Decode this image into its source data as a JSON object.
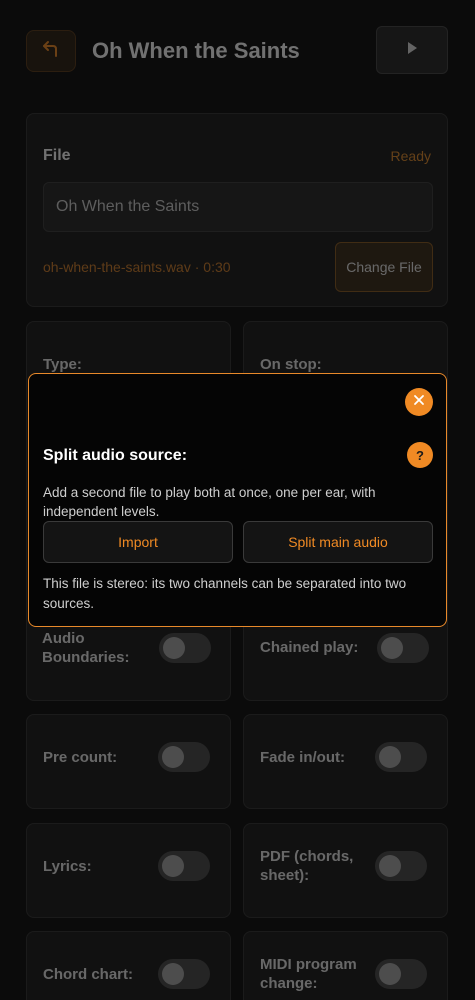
{
  "header": {
    "back_icon": "back-arrow-icon",
    "title": "Oh When the Saints",
    "play_icon": "play-icon"
  },
  "file": {
    "label": "File",
    "status": "Ready",
    "name_value": "Oh When the Saints",
    "meta": "oh-when-the-saints.wav · 0:30",
    "change_label": "Change File"
  },
  "tiles": {
    "type": "Type:",
    "on_stop": "On stop:",
    "audio_boundaries": "Audio Boundaries:",
    "chained_play": "Chained play:",
    "pre_count": "Pre count:",
    "fade": "Fade in/out:",
    "lyrics": "Lyrics:",
    "pdf": "PDF (chords, sheet):",
    "chord_chart": "Chord chart:",
    "midi": "MIDI program change:"
  },
  "modal": {
    "close_icon": "close-icon",
    "title": "Split audio source:",
    "help_label": "?",
    "description": "Add a second file to play both at once, one per ear, with independent levels.",
    "import_label": "Import",
    "split_label": "Split main audio",
    "note": "This file is stereo: its two channels can be separated into two sources."
  },
  "colors": {
    "accent": "#f08a24",
    "background": "#0b0b0b",
    "modal_border": "#e8892a"
  }
}
